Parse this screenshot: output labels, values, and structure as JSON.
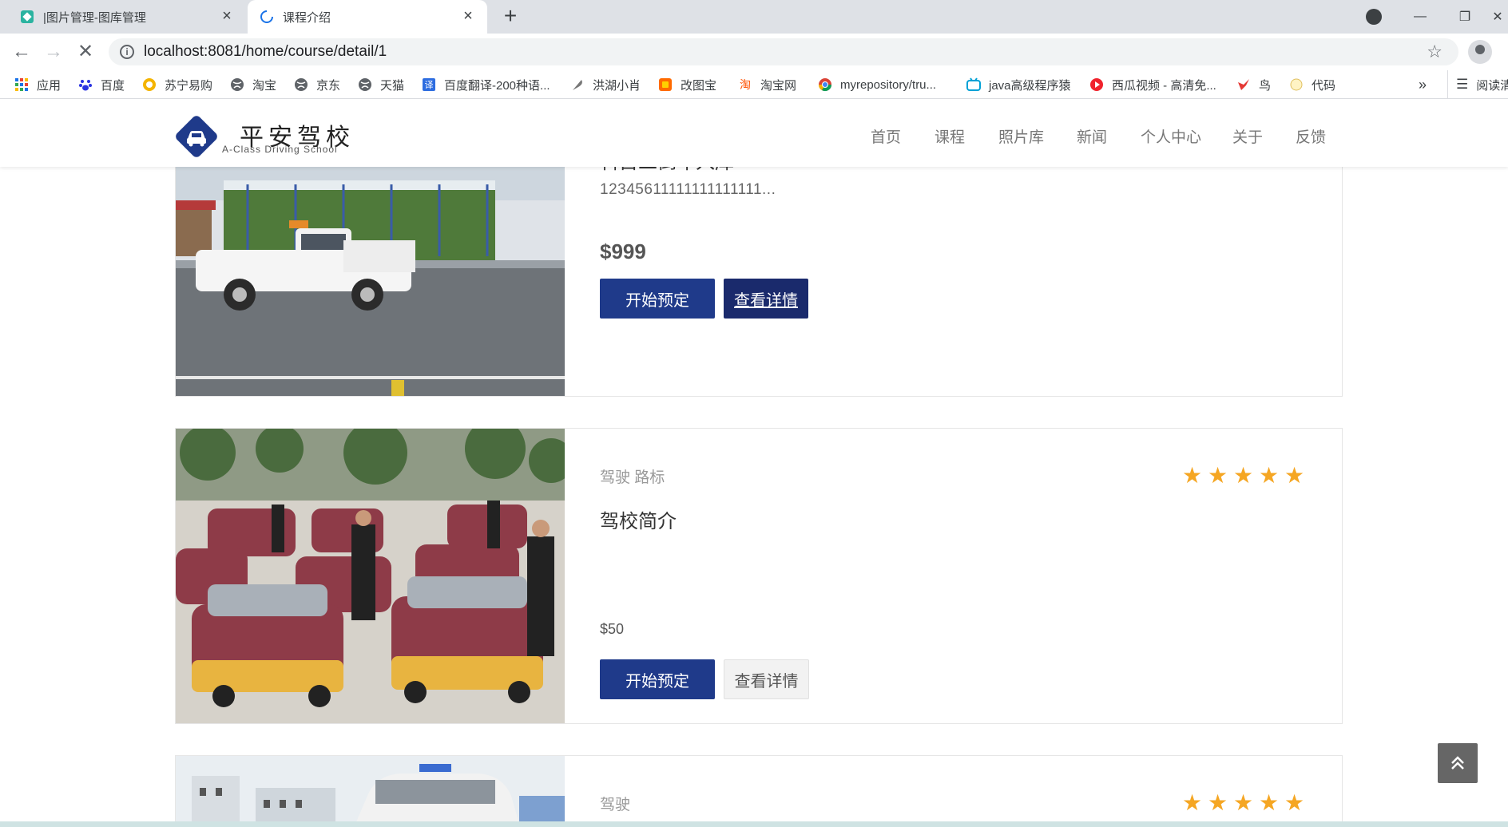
{
  "browser": {
    "tabs": [
      {
        "title": "|图片管理-图库管理",
        "active": false
      },
      {
        "title": "课程介绍",
        "active": true
      }
    ],
    "url": "localhost:8081/home/course/detail/1",
    "bookmarks": [
      {
        "label": "应用",
        "icon": "apps-grid-icon"
      },
      {
        "label": "百度",
        "icon": "baidu-paw-icon"
      },
      {
        "label": "苏宁易购",
        "icon": "suning-icon"
      },
      {
        "label": "淘宝",
        "icon": "globe-icon"
      },
      {
        "label": "京东",
        "icon": "globe-icon"
      },
      {
        "label": "天猫",
        "icon": "globe-icon"
      },
      {
        "label": "百度翻译-200种语...",
        "icon": "translate-icon"
      },
      {
        "label": "洪湖小肖",
        "icon": "feather-icon"
      },
      {
        "label": "改图宝",
        "icon": "image-edit-icon"
      },
      {
        "label": "淘宝网",
        "icon": "taobao-icon"
      },
      {
        "label": "myrepository/tru...",
        "icon": "chrome-icon"
      },
      {
        "label": "java高级程序猿",
        "icon": "bilibili-icon"
      },
      {
        "label": "西瓜视频 - 高清免...",
        "icon": "xigua-icon"
      },
      {
        "label": "鸟",
        "icon": "bird-icon"
      },
      {
        "label": "代码",
        "icon": "code-icon"
      }
    ],
    "bookmarks_overflow": "»",
    "reading_list": "阅读清"
  },
  "site": {
    "logo_title": "平安驾校",
    "logo_subtitle": "A-Class Driving School",
    "nav": [
      "首页",
      "课程",
      "照片库",
      "新闻",
      "个人中心",
      "关于",
      "反馈"
    ]
  },
  "courses": [
    {
      "title": "科目二倒车入库",
      "description": "12345611111111111111...",
      "price": "$999",
      "book_label": "开始预定",
      "detail_label": "查看详情"
    },
    {
      "category": "驾驶 路标",
      "title": "驾校简介",
      "price": "$50",
      "rating": 5,
      "book_label": "开始预定",
      "detail_label": "查看详情"
    },
    {
      "category": "驾驶",
      "rating": 5
    }
  ],
  "colors": {
    "primary_button": "#1f3a8a",
    "star": "#f5a623",
    "logo_badge": "#1f3a8a"
  }
}
